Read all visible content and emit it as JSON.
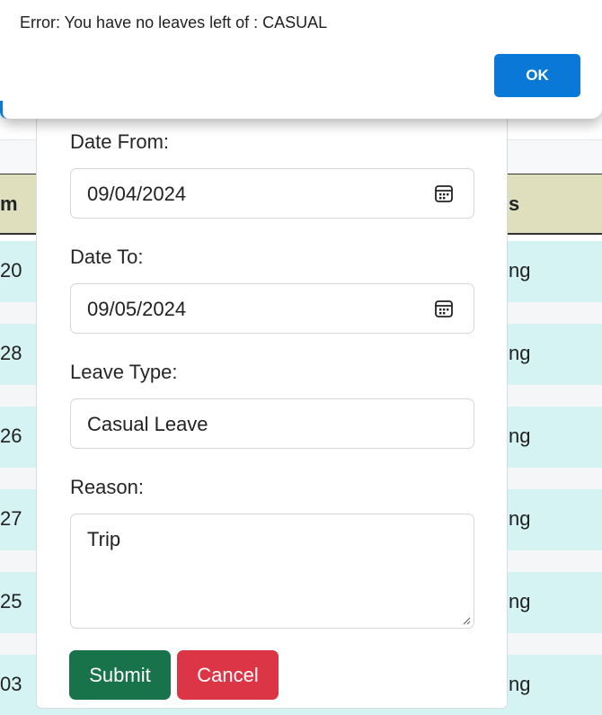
{
  "alert": {
    "message": "Error: You have no leaves left of : CASUAL",
    "ok_label": "OK"
  },
  "table": {
    "headers": {
      "left": "m",
      "right": "s"
    },
    "rows": [
      {
        "left": "20",
        "right": "ng"
      },
      {
        "left": "28",
        "right": "ng"
      },
      {
        "left": "26",
        "right": "ng"
      },
      {
        "left": "27",
        "right": "ng"
      },
      {
        "left": "25",
        "right": "ng"
      },
      {
        "left": "03",
        "right": "ng"
      }
    ]
  },
  "form": {
    "date_from_label": "Date From:",
    "date_from_value": "09/04/2024",
    "date_to_label": "Date To:",
    "date_to_value": "09/05/2024",
    "leave_type_label": "Leave Type:",
    "leave_type_value": "Casual Leave",
    "reason_label": "Reason:",
    "reason_value": "Trip",
    "submit_label": "Submit",
    "cancel_label": "Cancel"
  },
  "icons": {
    "date_picker": "calendar-icon",
    "textarea_resize": "resize-grip-icon"
  },
  "colors": {
    "ok_button": "#0a78d7",
    "submit_button": "#19734a",
    "cancel_button": "#dc3545",
    "table_header": "#dfdfbe",
    "table_row": "#d5f3f2"
  }
}
